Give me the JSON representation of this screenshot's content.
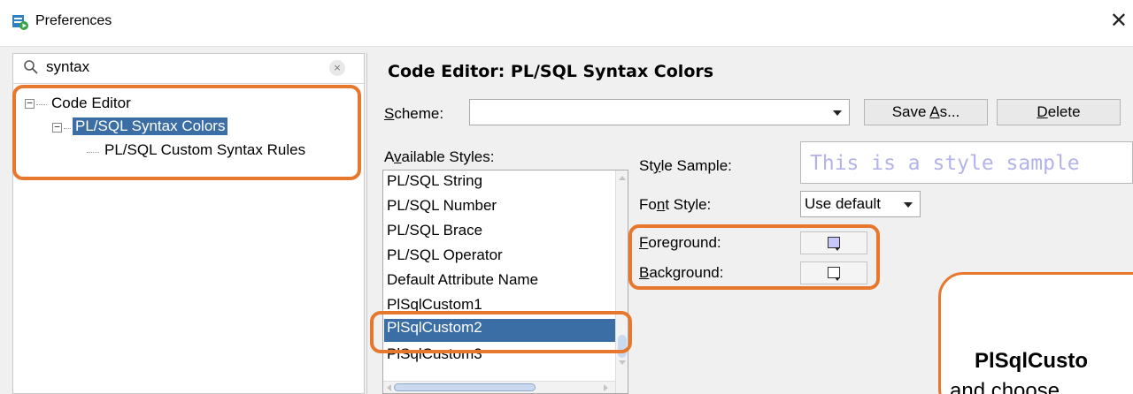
{
  "window": {
    "title": "Preferences",
    "close_glyph": "✕"
  },
  "search": {
    "value": "syntax",
    "clear_glyph": "×"
  },
  "tree": {
    "items": [
      {
        "label": "Code Editor",
        "level": 0,
        "expanded": true
      },
      {
        "label": "PL/SQL Syntax Colors",
        "level": 1,
        "expanded": true,
        "selected": true
      },
      {
        "label": "PL/SQL Custom Syntax Rules",
        "level": 2
      }
    ]
  },
  "panel": {
    "title": "Code Editor: PL/SQL Syntax Colors",
    "scheme_label_pre": "",
    "scheme_label_u": "S",
    "scheme_label_post": "cheme:",
    "scheme_value": "",
    "save_as_pre": "Save ",
    "save_as_u": "A",
    "save_as_post": "s...",
    "delete_u": "D",
    "delete_post": "elete",
    "available_pre": "A",
    "available_u": "v",
    "available_post": "ailable Styles:",
    "style_sample_pre": "St",
    "style_sample_u": "y",
    "style_sample_post": "le Sample:",
    "style_sample_text": "This is a style sample",
    "font_style_pre": "Fo",
    "font_style_u": "n",
    "font_style_post": "t Style:",
    "font_style_value": "Use default",
    "foreground_u": "F",
    "foreground_post": "oreground:",
    "background_u": "B",
    "background_post": "ackground:"
  },
  "styles": [
    "PL/SQL String",
    "PL/SQL Number",
    "PL/SQL Brace",
    "PL/SQL Operator",
    "Default Attribute Name",
    "PlSqlCustom1",
    "PlSqlCustom2",
    "PlSqlCustom3"
  ],
  "selected_style": "PlSqlCustom2",
  "colors": {
    "accent_orange": "#e8772e",
    "selection_blue": "#3b6ea5",
    "foreground_swatch": "#c8c8f8",
    "background_swatch": "#ffffff"
  },
  "callout": {
    "line1": "PlSqlCusto",
    "line2": "and choose"
  }
}
